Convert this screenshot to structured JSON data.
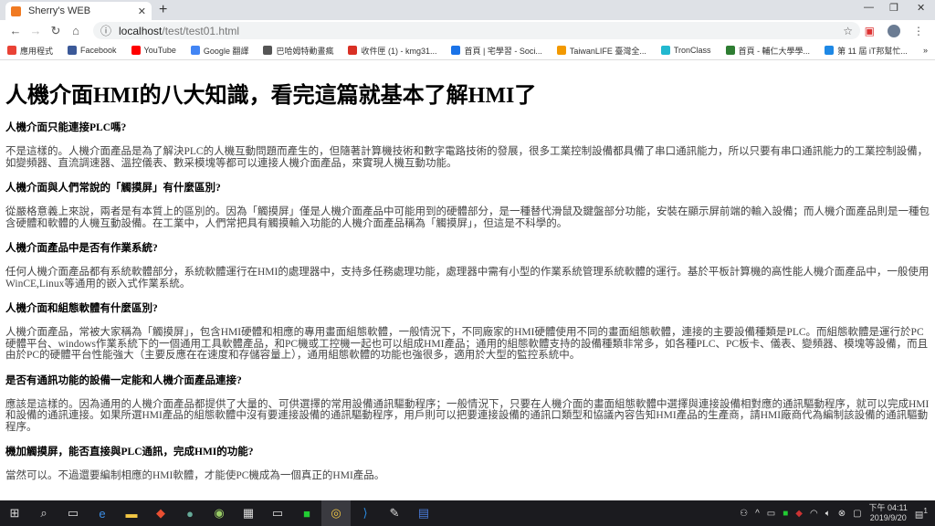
{
  "browser": {
    "tab_title": "Sherry's WEB",
    "url_host": "localhost",
    "url_path": "/test/test01.html",
    "bookmarks": [
      "應用程式",
      "Facebook",
      "YouTube",
      "Google 翻譯",
      "巴哈姆特動畫瘋",
      "收件匣 (1) - kmg31...",
      "首頁 | 宅學習 - Soci...",
      "TaiwanLIFE 臺灣全...",
      "TronClass",
      "首頁 - 輔仁大學學...",
      "第 11 屆 iT邦幫忙..."
    ],
    "bookmark_colors": [
      "#e94235",
      "#3b5998",
      "#ff0000",
      "#4285f4",
      "#555555",
      "#d93025",
      "#1a73e8",
      "#f29900",
      "#22b8cf",
      "#2e7d32",
      "#1e88e5"
    ]
  },
  "page": {
    "title": "人機介面HMI的八大知識，看完這篇就基本了解HMI了",
    "sections": [
      {
        "heading": "人機介面只能連接PLC嗎?",
        "body": "不是這樣的。人機介面產品是為了解決PLC的人機互動問題而產生的，但隨著計算機技術和數字電路技術的發展，很多工業控制設備都具備了串口通訊能力，所以只要有串口通訊能力的工業控制設備，如變頻器、直流調速器、溫控儀表、數采模塊等都可以連接人機介面產品，來實現人機互動功能。"
      },
      {
        "heading": "人機介面與人們常說的「觸摸屏」有什麼區別?",
        "body": "從嚴格意義上來說，兩者是有本質上的區別的。因為「觸摸屏」僅是人機介面產品中可能用到的硬體部分，是一種替代滑鼠及鍵盤部分功能，安裝在顯示屏前端的輸入設備；而人機介面產品則是一種包含硬體和軟體的人機互動設備。在工業中，人們常把具有觸摸輸入功能的人機介面產品稱為「觸摸屏」，但這是不科學的。"
      },
      {
        "heading": "人機介面產品中是否有作業系統?",
        "body": "任何人機介面產品都有系統軟體部分，系統軟體運行在HMI的處理器中，支持多任務處理功能，處理器中需有小型的作業系統管理系統軟體的運行。基於平板計算機的高性能人機介面產品中，一般使用WinCE,Linux等通用的嵌入式作業系統。"
      },
      {
        "heading": "人機介面和組態軟體有什麼區別?",
        "body": "人機介面產品，常被大家稱為「觸摸屏」，包含HMI硬體和相應的專用畫面組態軟體，一般情況下，不同廠家的HMI硬體使用不同的畫面組態軟體，連接的主要設備種類是PLC。而組態軟體是運行於PC硬體平台、windows作業系統下的一個通用工具軟體產品，和PC機或工控機一起也可以組成HMI產品；通用的組態軟體支持的設備種類非常多，如各種PLC、PC板卡、儀表、變頻器、模塊等設備，而且由於PC的硬體平台性能強大（主要反應在在速度和存儲容量上），通用組態軟體的功能也強很多，適用於大型的監控系統中。"
      },
      {
        "heading": "是否有通訊功能的設備一定能和人機介面產品連接?",
        "body": "應該是這樣的。因為通用的人機介面產品都提供了大量的、可供選擇的常用設備通訊驅動程序；一般情況下，只要在人機介面的畫面組態軟體中選擇與連接設備相對應的通訊驅動程序，就可以完成HMI和設備的通訊連接。如果所選HMI產品的組態軟體中沒有要連接設備的通訊驅動程序，用戶則可以把要連接設備的通訊口類型和協議內容告知HMI產品的生產商，請HMI廠商代為編制該設備的通訊驅動程序。"
      },
      {
        "heading": "機加觸摸屏，能否直接與PLC通訊，完成HMI的功能?",
        "body": "當然可以。不過還要編制相應的HMI軟體，才能使PC機成為一個真正的HMI產品。"
      }
    ]
  },
  "taskbar": {
    "time": "下午 04:11",
    "date": "2019/9/20",
    "notification_count": "1"
  }
}
